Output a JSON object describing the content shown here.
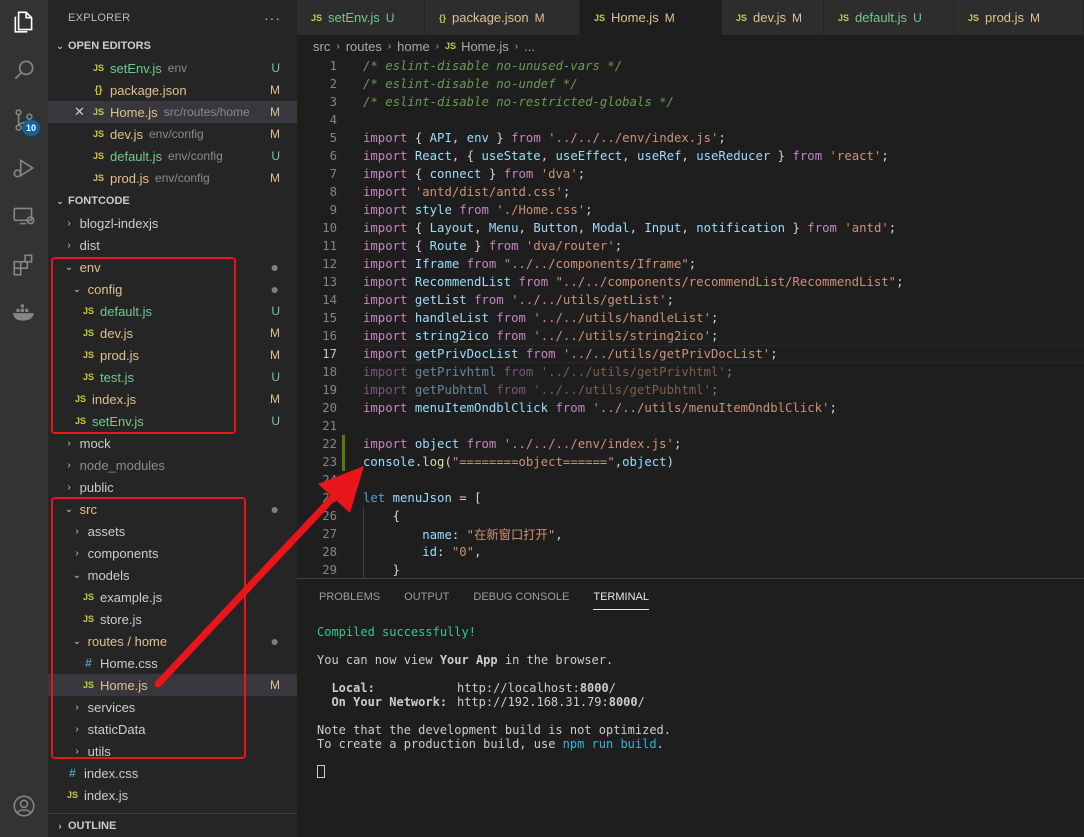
{
  "explorer": {
    "title": "EXPLORER",
    "more": "···",
    "open_editors": {
      "title": "OPEN EDITORS",
      "items": [
        {
          "name": "setEnv.js",
          "desc": "env",
          "status": "U",
          "icon": "JS"
        },
        {
          "name": "package.json",
          "desc": "",
          "status": "M",
          "icon": "{}"
        },
        {
          "name": "Home.js",
          "desc": "src/routes/home",
          "status": "M",
          "icon": "JS"
        },
        {
          "name": "dev.js",
          "desc": "env/config",
          "status": "M",
          "icon": "JS"
        },
        {
          "name": "default.js",
          "desc": "env/config",
          "status": "U",
          "icon": "JS"
        },
        {
          "name": "prod.js",
          "desc": "env/config",
          "status": "M",
          "icon": "JS"
        }
      ]
    },
    "project": {
      "title": "FONTCODE",
      "tree": [
        {
          "label": "blogzl-indexjs",
          "chev": "›"
        },
        {
          "label": "dist",
          "chev": "›"
        },
        {
          "label": "env",
          "chev": "⌄",
          "status": "●"
        },
        {
          "label": "config",
          "chev": "⌄",
          "status": "●"
        },
        {
          "label": "default.js",
          "icon": "JS",
          "status": "U"
        },
        {
          "label": "dev.js",
          "icon": "JS",
          "status": "M"
        },
        {
          "label": "prod.js",
          "icon": "JS",
          "status": "M"
        },
        {
          "label": "test.js",
          "icon": "JS",
          "status": "U"
        },
        {
          "label": "index.js",
          "icon": "JS",
          "status": "M"
        },
        {
          "label": "setEnv.js",
          "icon": "JS",
          "status": "U"
        },
        {
          "label": "mock",
          "chev": "›"
        },
        {
          "label": "node_modules",
          "chev": "›"
        },
        {
          "label": "public",
          "chev": "›"
        },
        {
          "label": "src",
          "chev": "⌄",
          "status": "●"
        },
        {
          "label": "assets",
          "chev": "›"
        },
        {
          "label": "components",
          "chev": "›"
        },
        {
          "label": "models",
          "chev": "⌄"
        },
        {
          "label": "example.js",
          "icon": "JS"
        },
        {
          "label": "store.js",
          "icon": "JS"
        },
        {
          "label": "routes / home",
          "chev": "⌄",
          "status": "●"
        },
        {
          "label": "Home.css",
          "icon": "#"
        },
        {
          "label": "Home.js",
          "icon": "JS",
          "status": "M"
        },
        {
          "label": "services",
          "chev": "›"
        },
        {
          "label": "staticData",
          "chev": "›"
        },
        {
          "label": "utils",
          "chev": "›"
        },
        {
          "label": "index.css",
          "icon": "#"
        },
        {
          "label": "index.js",
          "icon": "JS"
        }
      ]
    },
    "outline": "OUTLINE"
  },
  "activity": {
    "icons": [
      "files-icon",
      "search-icon",
      "source-control-icon",
      "run-debug-icon",
      "remote-explorer-icon",
      "extensions-icon",
      "docker-icon",
      "account-icon"
    ],
    "scm_badge": "10"
  },
  "tabs": [
    {
      "name": "setEnv.js",
      "icon": "JS",
      "status": "U"
    },
    {
      "name": "package.json",
      "icon": "{}",
      "status": "M"
    },
    {
      "name": "Home.js",
      "icon": "JS",
      "status": "M",
      "active": true
    },
    {
      "name": "dev.js",
      "icon": "JS",
      "status": "M"
    },
    {
      "name": "default.js",
      "icon": "JS",
      "status": "U"
    },
    {
      "name": "prod.js",
      "icon": "JS",
      "status": "M"
    }
  ],
  "breadcrumb": [
    "src",
    "routes",
    "home",
    "Home.js",
    "..."
  ],
  "editor": {
    "current_line": 17,
    "lines": [
      {
        "n": "1",
        "t": [
          [
            "cm",
            "/* eslint-disable no-unused-vars */"
          ]
        ]
      },
      {
        "n": "2",
        "t": [
          [
            "cm",
            "/* eslint-disable no-undef */"
          ]
        ]
      },
      {
        "n": "3",
        "t": [
          [
            "cm",
            "/* eslint-disable no-restricted-globals */"
          ]
        ]
      },
      {
        "n": "4",
        "t": []
      },
      {
        "n": "5",
        "t": [
          [
            "kw",
            "import"
          ],
          [
            "pl",
            " { "
          ],
          [
            "vr",
            "API"
          ],
          [
            "pl",
            ", "
          ],
          [
            "vr",
            "env"
          ],
          [
            "pl",
            " } "
          ],
          [
            "kw",
            "from"
          ],
          [
            "pl",
            " "
          ],
          [
            "str",
            "'../../../env/index.js'"
          ],
          [
            "pl",
            ";"
          ]
        ]
      },
      {
        "n": "6",
        "t": [
          [
            "kw",
            "import"
          ],
          [
            "pl",
            " "
          ],
          [
            "vr",
            "React"
          ],
          [
            "pl",
            ", { "
          ],
          [
            "vr",
            "useState"
          ],
          [
            "pl",
            ", "
          ],
          [
            "vr",
            "useEffect"
          ],
          [
            "pl",
            ", "
          ],
          [
            "vr",
            "useRef"
          ],
          [
            "pl",
            ", "
          ],
          [
            "vr",
            "useReducer"
          ],
          [
            "pl",
            " } "
          ],
          [
            "kw",
            "from"
          ],
          [
            "pl",
            " "
          ],
          [
            "str",
            "'react'"
          ],
          [
            "pl",
            ";"
          ]
        ]
      },
      {
        "n": "7",
        "t": [
          [
            "kw",
            "import"
          ],
          [
            "pl",
            " { "
          ],
          [
            "vr",
            "connect"
          ],
          [
            "pl",
            " } "
          ],
          [
            "kw",
            "from"
          ],
          [
            "pl",
            " "
          ],
          [
            "str",
            "'dva'"
          ],
          [
            "pl",
            ";"
          ]
        ]
      },
      {
        "n": "8",
        "t": [
          [
            "kw",
            "import"
          ],
          [
            "pl",
            " "
          ],
          [
            "str",
            "'antd/dist/antd.css'"
          ],
          [
            "pl",
            ";"
          ]
        ]
      },
      {
        "n": "9",
        "t": [
          [
            "kw",
            "import"
          ],
          [
            "pl",
            " "
          ],
          [
            "vr",
            "style"
          ],
          [
            "pl",
            " "
          ],
          [
            "kw",
            "from"
          ],
          [
            "pl",
            " "
          ],
          [
            "str",
            "'./Home.css'"
          ],
          [
            "pl",
            ";"
          ]
        ]
      },
      {
        "n": "10",
        "t": [
          [
            "kw",
            "import"
          ],
          [
            "pl",
            " { "
          ],
          [
            "vr",
            "Layout"
          ],
          [
            "pl",
            ", "
          ],
          [
            "vr",
            "Menu"
          ],
          [
            "pl",
            ", "
          ],
          [
            "vr",
            "Button"
          ],
          [
            "pl",
            ", "
          ],
          [
            "vr",
            "Modal"
          ],
          [
            "pl",
            ", "
          ],
          [
            "vr",
            "Input"
          ],
          [
            "pl",
            ", "
          ],
          [
            "vr",
            "notification"
          ],
          [
            "pl",
            " } "
          ],
          [
            "kw",
            "from"
          ],
          [
            "pl",
            " "
          ],
          [
            "str",
            "'antd'"
          ],
          [
            "pl",
            ";"
          ]
        ]
      },
      {
        "n": "11",
        "t": [
          [
            "kw",
            "import"
          ],
          [
            "pl",
            " { "
          ],
          [
            "vr",
            "Route"
          ],
          [
            "pl",
            " } "
          ],
          [
            "kw",
            "from"
          ],
          [
            "pl",
            " "
          ],
          [
            "str",
            "'dva/router'"
          ],
          [
            "pl",
            ";"
          ]
        ]
      },
      {
        "n": "12",
        "t": [
          [
            "kw",
            "import"
          ],
          [
            "pl",
            " "
          ],
          [
            "vr",
            "Iframe"
          ],
          [
            "pl",
            " "
          ],
          [
            "kw",
            "from"
          ],
          [
            "pl",
            " "
          ],
          [
            "str",
            "\"../../components/Iframe\""
          ],
          [
            "pl",
            ";"
          ]
        ]
      },
      {
        "n": "13",
        "t": [
          [
            "kw",
            "import"
          ],
          [
            "pl",
            " "
          ],
          [
            "vr",
            "RecommendList"
          ],
          [
            "pl",
            " "
          ],
          [
            "kw",
            "from"
          ],
          [
            "pl",
            " "
          ],
          [
            "str",
            "\"../../components/recommendList/RecommendList\""
          ],
          [
            "pl",
            ";"
          ]
        ]
      },
      {
        "n": "14",
        "t": [
          [
            "kw",
            "import"
          ],
          [
            "pl",
            " "
          ],
          [
            "vr",
            "getList"
          ],
          [
            "pl",
            " "
          ],
          [
            "kw",
            "from"
          ],
          [
            "pl",
            " "
          ],
          [
            "str",
            "'../../utils/getList'"
          ],
          [
            "pl",
            ";"
          ]
        ]
      },
      {
        "n": "15",
        "t": [
          [
            "kw",
            "import"
          ],
          [
            "pl",
            " "
          ],
          [
            "vr",
            "handleList"
          ],
          [
            "pl",
            " "
          ],
          [
            "kw",
            "from"
          ],
          [
            "pl",
            " "
          ],
          [
            "str",
            "'../../utils/handleList'"
          ],
          [
            "pl",
            ";"
          ]
        ]
      },
      {
        "n": "16",
        "t": [
          [
            "kw",
            "import"
          ],
          [
            "pl",
            " "
          ],
          [
            "vr",
            "string2ico"
          ],
          [
            "pl",
            " "
          ],
          [
            "kw",
            "from"
          ],
          [
            "pl",
            " "
          ],
          [
            "str",
            "'../../utils/string2ico'"
          ],
          [
            "pl",
            ";"
          ]
        ]
      },
      {
        "n": "17",
        "t": [
          [
            "kw",
            "import"
          ],
          [
            "pl",
            " "
          ],
          [
            "vr",
            "getPrivDocList"
          ],
          [
            "pl",
            " "
          ],
          [
            "kw",
            "from"
          ],
          [
            "pl",
            " "
          ],
          [
            "str",
            "'../../utils/getPrivDocList'"
          ],
          [
            "pl",
            ";"
          ]
        ]
      },
      {
        "n": "18",
        "dim": true,
        "t": [
          [
            "kw",
            "import"
          ],
          [
            "pl",
            " "
          ],
          [
            "vr",
            "getPrivhtml"
          ],
          [
            "pl",
            " "
          ],
          [
            "kw",
            "from"
          ],
          [
            "pl",
            " "
          ],
          [
            "str",
            "'../../utils/getPrivhtml'"
          ],
          [
            "pl",
            ";"
          ]
        ]
      },
      {
        "n": "19",
        "dim": true,
        "t": [
          [
            "kw",
            "import"
          ],
          [
            "pl",
            " "
          ],
          [
            "vr",
            "getPubhtml"
          ],
          [
            "pl",
            " "
          ],
          [
            "kw",
            "from"
          ],
          [
            "pl",
            " "
          ],
          [
            "str",
            "'../../utils/getPubhtml'"
          ],
          [
            "pl",
            ";"
          ]
        ]
      },
      {
        "n": "20",
        "t": [
          [
            "kw",
            "import"
          ],
          [
            "pl",
            " "
          ],
          [
            "vr",
            "menuItemOndblClick"
          ],
          [
            "pl",
            " "
          ],
          [
            "kw",
            "from"
          ],
          [
            "pl",
            " "
          ],
          [
            "str",
            "'../../utils/menuItemOndblClick'"
          ],
          [
            "pl",
            ";"
          ]
        ]
      },
      {
        "n": "21",
        "t": []
      },
      {
        "n": "22",
        "t": [
          [
            "kw",
            "import"
          ],
          [
            "pl",
            " "
          ],
          [
            "vr",
            "object"
          ],
          [
            "pl",
            " "
          ],
          [
            "kw",
            "from"
          ],
          [
            "pl",
            " "
          ],
          [
            "str",
            "'../../../env/index.js'"
          ],
          [
            "pl",
            ";"
          ]
        ]
      },
      {
        "n": "23",
        "t": [
          [
            "vr",
            "console"
          ],
          [
            "pl",
            "."
          ],
          [
            "fn",
            "log"
          ],
          [
            "pl",
            "("
          ],
          [
            "str",
            "\"========object======\""
          ],
          [
            "pl",
            ","
          ],
          [
            "vr",
            "object"
          ],
          [
            "pl",
            ")"
          ]
        ]
      },
      {
        "n": "24",
        "t": []
      },
      {
        "n": "25",
        "t": [
          [
            "kw2",
            "let"
          ],
          [
            "pl",
            " "
          ],
          [
            "vr",
            "menuJson"
          ],
          [
            "pl",
            " = ["
          ]
        ]
      },
      {
        "n": "26",
        "t": [
          [
            "pl",
            "    {"
          ]
        ]
      },
      {
        "n": "27",
        "t": [
          [
            "pl",
            "        "
          ],
          [
            "vr",
            "name"
          ],
          [
            "pl",
            ": "
          ],
          [
            "str",
            "\"在新窗口打开\""
          ],
          [
            "pl",
            ","
          ]
        ]
      },
      {
        "n": "28",
        "t": [
          [
            "pl",
            "        "
          ],
          [
            "vr",
            "id"
          ],
          [
            "pl",
            ": "
          ],
          [
            "str",
            "\"0\""
          ],
          [
            "pl",
            ","
          ]
        ]
      },
      {
        "n": "29",
        "t": [
          [
            "pl",
            "    }"
          ]
        ]
      }
    ]
  },
  "panel": {
    "tabs": [
      "PROBLEMS",
      "OUTPUT",
      "DEBUG CONSOLE",
      "TERMINAL"
    ],
    "active_tab": "TERMINAL",
    "terminal": {
      "compiled": "Compiled successfully!",
      "view_prefix": "You can now view ",
      "app_name": "Your App",
      "view_suffix": " in the browser.",
      "local_label": "  Local:",
      "local_url_pre": "http://localhost:",
      "local_port": "8000",
      "local_url_post": "/",
      "net_label": "  On Your Network:",
      "net_url_pre": "http://192.168.31.79:",
      "net_port": "8000",
      "net_url_post": "/",
      "note1": "Note that the development build is not optimized.",
      "note2_pre": "To create a production build, use ",
      "note2_cmd": "npm run build",
      "note2_post": "."
    }
  },
  "colors": {
    "annotation": "#e8151b",
    "modified": "#e2c08d",
    "untracked": "#73c991"
  }
}
